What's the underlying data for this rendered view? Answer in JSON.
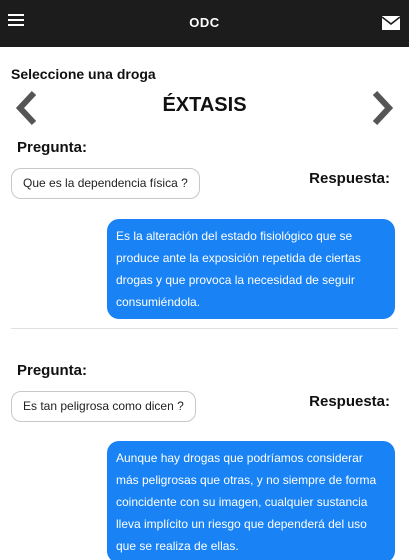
{
  "header": {
    "title": "ODC",
    "menu_icon": "hamburger-menu-icon",
    "mail_icon": "envelope-icon",
    "background": "#1c1c1c"
  },
  "selector": {
    "label": "Seleccione una droga",
    "drug_name": "ÉXTASIS",
    "prev_icon": "chevron-left-icon",
    "next_icon": "chevron-right-icon"
  },
  "qa": [
    {
      "question_label": "Pregunta:",
      "question": "Que es la dependencia física ?",
      "answer_label": "Respuesta:",
      "answer": "Es la alteración del estado fisiológico que se produce ante la exposición repetida de ciertas drogas y que provoca la necesidad de seguir consumiéndola."
    },
    {
      "question_label": "Pregunta:",
      "question": "Es tan peligrosa como dicen ?",
      "answer_label": "Respuesta:",
      "answer": "Aunque hay drogas que podríamos considerar más peligrosas que otras, y no siempre de forma coincidente con su imagen, cualquier sustancia lleva implícito un riesgo que dependerá del uso que se realiza de ellas."
    }
  ],
  "colors": {
    "answer_bubble": "#1982f5",
    "question_border": "#c8c8c8",
    "arrow": "#555555"
  }
}
